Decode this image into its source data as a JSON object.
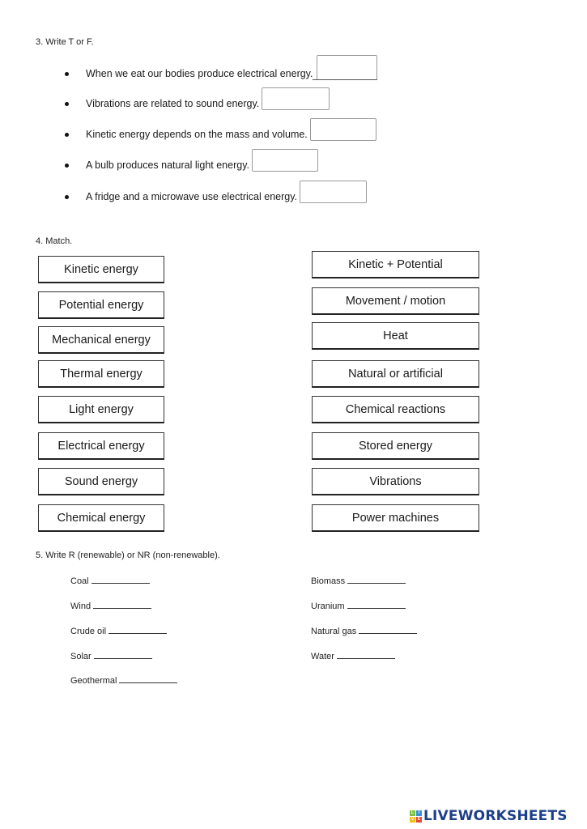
{
  "section3": {
    "heading": "3. Write T or F.",
    "items": [
      {
        "text": "When we eat our bodies produce electrical energy.",
        "answer": ""
      },
      {
        "text": "Vibrations are related to sound energy.",
        "answer": ""
      },
      {
        "text": "Kinetic energy depends on the mass and volume.",
        "answer": ""
      },
      {
        "text": "A bulb produces natural light energy.",
        "answer": ""
      },
      {
        "text": "A fridge and a microwave use electrical energy.",
        "answer": ""
      }
    ]
  },
  "section4": {
    "heading": "4. Match.",
    "left": [
      "Kinetic energy",
      "Potential energy",
      "Mechanical energy",
      "Thermal energy",
      "Light energy",
      "Electrical energy",
      "Sound energy",
      "Chemical energy"
    ],
    "right": [
      "Kinetic + Potential",
      "Movement / motion",
      "Heat",
      "Natural or artificial",
      "Chemical reactions",
      "Stored energy",
      "Vibrations",
      "Power machines"
    ]
  },
  "section5": {
    "heading": "5. Write R (renewable) or NR (non-renewable).",
    "left": [
      "Coal",
      "Wind",
      "Crude oil",
      "Solar",
      "Geothermal"
    ],
    "right": [
      "Biomass",
      "Uranium",
      "Natural gas",
      "Water"
    ]
  },
  "logo": {
    "squares": [
      "L",
      "I",
      "V",
      "E"
    ],
    "colors": [
      "#7cc242",
      "#3b8fd9",
      "#f4c01f",
      "#e8473a"
    ],
    "text": "LIVEWORKSHEETS"
  }
}
